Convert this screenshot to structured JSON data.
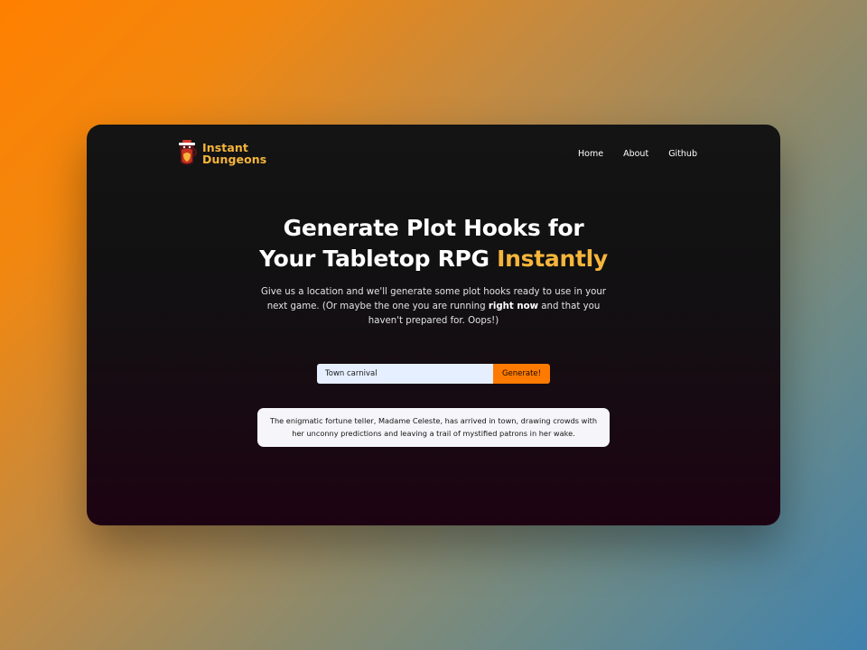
{
  "brand": {
    "name_line1": "Instant",
    "name_line2": "Dungeons"
  },
  "nav": {
    "links": [
      {
        "label": "Home"
      },
      {
        "label": "About"
      },
      {
        "label": "Github"
      }
    ]
  },
  "hero": {
    "title_line1": "Generate Plot Hooks for",
    "title_line2_prefix": "Your Tabletop RPG ",
    "title_line2_accent": "Instantly",
    "subtitle_before": "Give us a location and we'll generate some plot hooks ready to use in your next game. (Or maybe the one you are running ",
    "subtitle_bold": "right now",
    "subtitle_after": " and that you haven't prepared for. Oops!)"
  },
  "search": {
    "value": "Town carnival",
    "button_label": "Generate!"
  },
  "result": {
    "text": "The enigmatic fortune teller, Madame Celeste, has arrived in town, drawing crowds with her unconny predictions and leaving a trail of mystified patrons in her wake."
  },
  "colors": {
    "accent_gold": "#f6b53b",
    "button_orange": "#ff7a00",
    "input_bg": "#e6efff",
    "card_bg": "#f6f6fa"
  },
  "icons": {
    "logo": "dungeon-mug-logo-icon"
  }
}
